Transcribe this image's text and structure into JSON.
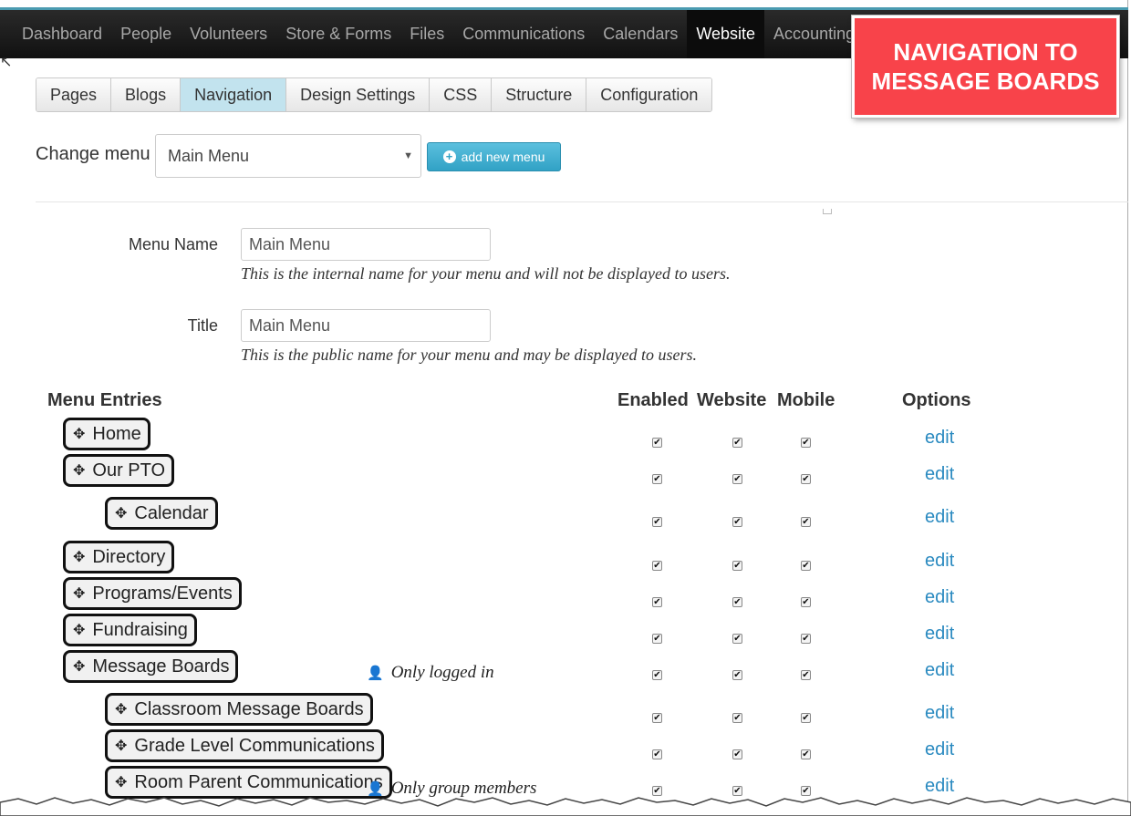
{
  "topnav": [
    "Dashboard",
    "People",
    "Volunteers",
    "Store & Forms",
    "Files",
    "Communications",
    "Calendars",
    "Website",
    "Accounting"
  ],
  "topnav_active": "Website",
  "callout": {
    "line1": "NAVIGATION TO",
    "line2": "MESSAGE BOARDS",
    "color": "#f8434a"
  },
  "subtabs": [
    "Pages",
    "Blogs",
    "Navigation",
    "Design Settings",
    "CSS",
    "Structure",
    "Configuration"
  ],
  "subtabs_active": "Navigation",
  "change_menu": {
    "label": "Change menu",
    "selected": "Main Menu",
    "add_button": "add new menu"
  },
  "form": {
    "menu_name": {
      "label": "Menu Name",
      "value": "Main Menu",
      "help": "This is the internal name for your menu and will not be displayed to users."
    },
    "title": {
      "label": "Title",
      "value": "Main Menu",
      "help": "This is the public name for your menu and may be displayed to users."
    }
  },
  "table": {
    "headers": {
      "entries": "Menu Entries",
      "enabled": "Enabled",
      "website": "Website",
      "mobile": "Mobile",
      "options": "Options"
    },
    "rows": [
      {
        "label": "Home",
        "level": 0,
        "enabled": true,
        "website": true,
        "mobile": true,
        "action": "edit",
        "note": ""
      },
      {
        "label": "Our PTO",
        "level": 0,
        "enabled": true,
        "website": true,
        "mobile": true,
        "action": "edit",
        "note": ""
      },
      {
        "label": "Calendar",
        "level": 1,
        "enabled": true,
        "website": true,
        "mobile": true,
        "action": "edit",
        "note": ""
      },
      {
        "label": "Directory",
        "level": 0,
        "enabled": true,
        "website": true,
        "mobile": true,
        "action": "edit",
        "note": ""
      },
      {
        "label": "Programs/Events",
        "level": 0,
        "enabled": true,
        "website": true,
        "mobile": true,
        "action": "edit",
        "note": ""
      },
      {
        "label": "Fundraising",
        "level": 0,
        "enabled": true,
        "website": true,
        "mobile": true,
        "action": "edit",
        "note": ""
      },
      {
        "label": "Message Boards",
        "level": 0,
        "enabled": true,
        "website": true,
        "mobile": true,
        "action": "edit",
        "note": "Only logged in"
      },
      {
        "label": "Classroom Message Boards",
        "level": 1,
        "enabled": true,
        "website": true,
        "mobile": true,
        "action": "edit",
        "note": ""
      },
      {
        "label": "Grade Level Communications",
        "level": 1,
        "enabled": true,
        "website": true,
        "mobile": true,
        "action": "edit",
        "note": ""
      },
      {
        "label": "Room Parent Communications",
        "level": 1,
        "enabled": true,
        "website": true,
        "mobile": true,
        "action": "edit",
        "note": "Only group members"
      }
    ]
  }
}
